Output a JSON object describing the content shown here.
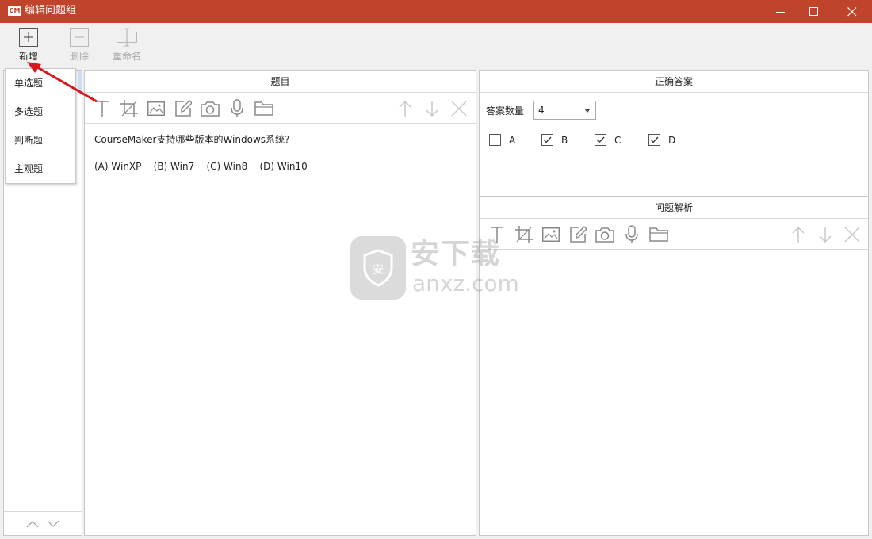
{
  "window": {
    "logo": "CM",
    "title": "编辑问题组"
  },
  "toolbar": {
    "add_label": "新增",
    "delete_label": "删除",
    "rename_label": "重命名"
  },
  "question_types": [
    "单选题",
    "多选题",
    "判断题",
    "主观题"
  ],
  "question_panel": {
    "title": "题目",
    "question_text": "CourseMaker支持哪些版本的Windows系统?",
    "options_line": "(A) WinXP    (B) Win7    (C) Win8    (D) Win10"
  },
  "answer_panel": {
    "title": "正确答案",
    "count_label": "答案数量",
    "count_value": "4",
    "choices": [
      {
        "label": "A",
        "checked": false
      },
      {
        "label": "B",
        "checked": true
      },
      {
        "label": "C",
        "checked": true
      },
      {
        "label": "D",
        "checked": true
      }
    ]
  },
  "analysis_panel": {
    "title": "问题解析"
  },
  "watermark": {
    "text": "安下载",
    "url": "anxz.com"
  },
  "colors": {
    "titlebar": "#c0442b",
    "arrow": "#d6191f"
  },
  "icons": [
    "text-icon",
    "crop-icon",
    "image-icon",
    "pen-icon",
    "camera-icon",
    "microphone-icon",
    "folder-icon",
    "arrow-up-icon",
    "arrow-down-icon",
    "close-icon"
  ]
}
